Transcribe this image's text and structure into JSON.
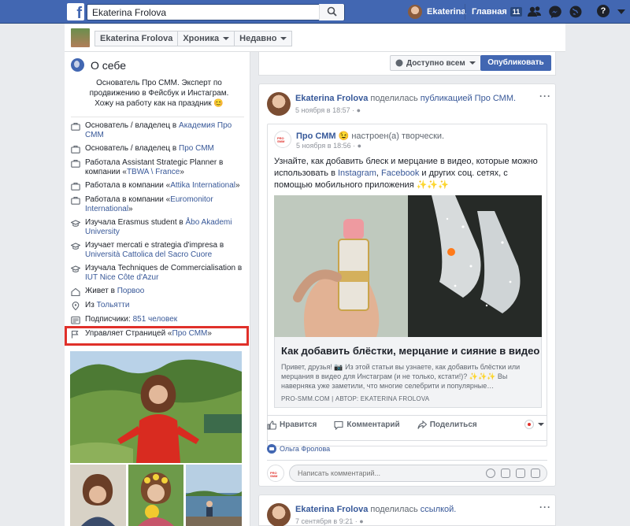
{
  "topbar": {
    "search_value": "Ekaterina Frolova",
    "user_name": "Ekaterina",
    "home_label": "Главная",
    "home_badge": "11",
    "help_icon": "?"
  },
  "subheader": {
    "name_tab": "Ekaterina Frolova",
    "timeline_tab": "Хроника",
    "recent_tab": "Недавно"
  },
  "about": {
    "title": "О себе",
    "bio": "Основатель Про СММ. Эксперт по продвижению в Фейсбук и Инстаграм. Хожу на работу как на праздник 😊",
    "items": [
      {
        "icon": "briefcase-icon",
        "text": "Основатель / владелец в ",
        "link": "Академия Про СММ"
      },
      {
        "icon": "briefcase-icon",
        "text": "Основатель / владелец в ",
        "link": "Про СММ"
      },
      {
        "icon": "briefcase-icon",
        "text": "Работала Assistant Strategic Planner в компании «",
        "link": "TBWA \\ France",
        "tail": "»"
      },
      {
        "icon": "briefcase-icon",
        "text": "Работала в компании «",
        "link": "Attika International",
        "tail": "»"
      },
      {
        "icon": "briefcase-icon",
        "text": "Работала в компании «",
        "link": "Euromonitor International",
        "tail": "»"
      },
      {
        "icon": "graduation-cap-icon",
        "text": "Изучала Erasmus student в ",
        "link": "Åbo Akademi University"
      },
      {
        "icon": "graduation-cap-icon",
        "text": "Изучает mercati e strategia d'impresa в ",
        "link": "Università Cattolica del Sacro Cuore"
      },
      {
        "icon": "graduation-cap-icon",
        "text": "Изучала Techniques de Commercialisation в ",
        "link": "IUT Nice Côte d'Azur"
      },
      {
        "icon": "home-icon",
        "text": "Живет в ",
        "link": "Порвоо"
      },
      {
        "icon": "location-pin-icon",
        "text": "Из ",
        "link": "Тольятти"
      },
      {
        "icon": "followers-icon",
        "text": "Подписчики: ",
        "link": "851 человек"
      },
      {
        "icon": "flag-icon",
        "text": "Управляет Страницей «",
        "link": "Про СММ",
        "tail": "»"
      }
    ]
  },
  "composer": {
    "audience_label": "Доступно всем",
    "publish_label": "Опубликовать"
  },
  "post": {
    "author": "Ekaterina Frolova",
    "action_text": " поделилась ",
    "action_link": "публикацией Про СММ.",
    "date": "5 ноября в 18:57",
    "shared": {
      "page": "Про СММ",
      "feeling": " 😉 настроен(а) творчески.",
      "date": "5 ноября в 18:56",
      "text_1": "Узнайте, как добавить блеск и мерцание в видео, которые можно использовать в ",
      "text_link1": "Instagram",
      "text_2": ", ",
      "text_link2": "Facebook",
      "text_3": " и других соц. сетях, с помощью мобильного приложения ✨✨✨",
      "link_title": "Как добавить блёстки, мерцание и сияние в видео",
      "link_desc": "Привет, друзья! 📷 Из этой статьи вы узнаете, как добавить блёстки или мерцания в видео для Инстаграм (и не только, кстати!)? ✨✨✨ Вы наверняка уже заметили, что многие селебрити и популярные…",
      "link_source": "PRO-SMM.COM | АВТОР: EKATERINA FROLOVA"
    },
    "like_label": "Нравится",
    "comment_label": "Комментарий",
    "share_label": "Поделиться",
    "liked_by": "Ольга Фролова",
    "comment_placeholder": "Написать комментарий..."
  },
  "post2": {
    "author": "Ekaterina Frolova",
    "action_text": " поделилась ",
    "action_link": "ссылкой.",
    "date": "7 сентября в 9:21"
  }
}
